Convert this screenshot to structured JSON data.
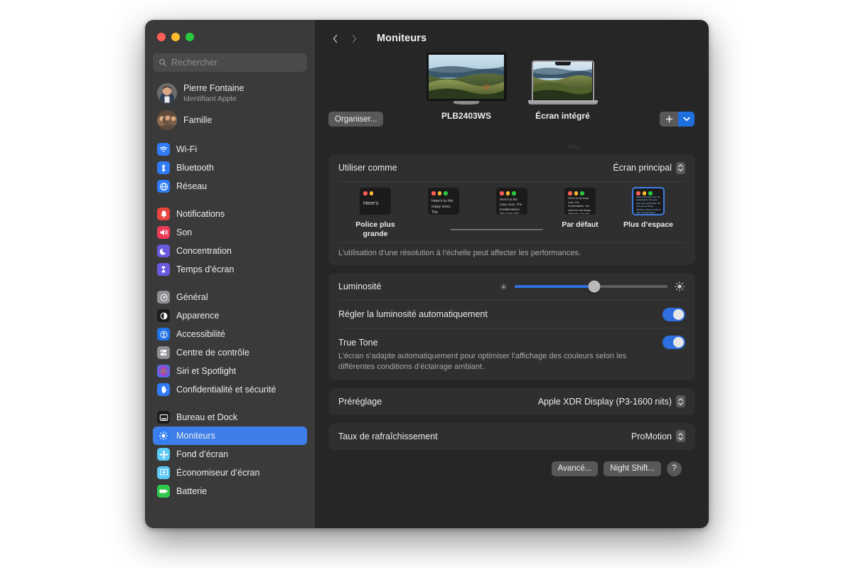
{
  "window": {
    "traffic_lights": [
      "close",
      "minimize",
      "zoom"
    ]
  },
  "sidebar": {
    "search": {
      "placeholder": "Rechercher",
      "value": ""
    },
    "accounts": [
      {
        "name": "Pierre Fontaine",
        "subtitle": "Identifiant Apple",
        "avatar": "user-photo"
      },
      {
        "name": "Famille",
        "avatar": "family-photos"
      }
    ],
    "groups": [
      {
        "items": [
          {
            "label": "Wi-Fi",
            "icon": "wifi-icon",
            "color": "#2f7cf6"
          },
          {
            "label": "Bluetooth",
            "icon": "bluetooth-icon",
            "color": "#2f7cf6"
          },
          {
            "label": "Réseau",
            "icon": "globe-icon",
            "color": "#2f7cf6"
          }
        ]
      },
      {
        "items": [
          {
            "label": "Notifications",
            "icon": "bell-icon",
            "color": "#e5453c"
          },
          {
            "label": "Son",
            "icon": "speaker-icon",
            "color": "#ec3b58"
          },
          {
            "label": "Concentration",
            "icon": "moon-icon",
            "color": "#6a5ae0"
          },
          {
            "label": "Temps d’écran",
            "icon": "hourglass-icon",
            "color": "#6a5ae0"
          }
        ]
      },
      {
        "items": [
          {
            "label": "Général",
            "icon": "gear-icon",
            "color": "#8e8e93"
          },
          {
            "label": "Apparence",
            "icon": "contrast-icon",
            "color": "#1c1c1e"
          },
          {
            "label": "Accessibilité",
            "icon": "accessibility-icon",
            "color": "#1d72e8"
          },
          {
            "label": "Centre de contrôle",
            "icon": "control-center-icon",
            "color": "#8e8e93"
          },
          {
            "label": "Siri et Spotlight",
            "icon": "siri-icon",
            "color": "#c13fa0"
          },
          {
            "label": "Confidentialité et sécurité",
            "icon": "hand-icon",
            "color": "#2f7cf6"
          }
        ]
      },
      {
        "items": [
          {
            "label": "Bureau et Dock",
            "icon": "desktop-dock-icon",
            "color": "#1c1c1e"
          },
          {
            "label": "Moniteurs",
            "icon": "brightness-icon",
            "color": "#2f7cf6",
            "selected": true
          },
          {
            "label": "Fond d’écran",
            "icon": "wallpaper-icon",
            "color": "#5bc8f5"
          },
          {
            "label": "Économiseur d’écran",
            "icon": "screensaver-icon",
            "color": "#5bc8f5"
          },
          {
            "label": "Batterie",
            "icon": "battery-icon",
            "color": "#30c94f"
          }
        ]
      }
    ]
  },
  "toolbar": {
    "back_icon": "chevron-left-icon",
    "forward_icon": "chevron-right-icon",
    "title": "Moniteurs"
  },
  "display_picker": {
    "displays": [
      {
        "name": "PLB2403WS",
        "type": "external-monitor",
        "selected": false
      },
      {
        "name": "Écran intégré",
        "type": "laptop",
        "selected": true
      }
    ],
    "arrange_button": "Organiser...",
    "add_button_icon": "plus-icon",
    "add_menu_icon": "chevron-down-icon"
  },
  "use_as": {
    "label": "Utiliser comme",
    "value": "Écran principal"
  },
  "resolution": {
    "options": [
      {
        "label": "Police plus grande",
        "preview": "Here’s",
        "selected": false
      },
      {
        "label": "",
        "preview": "Here’s to the crazy ones. The troublemakers.",
        "selected": false
      },
      {
        "label": "",
        "preview": "Here’s to the crazy ones. The troublemakers. The ones who see things differently.",
        "selected": false
      },
      {
        "label": "Par défaut",
        "preview": "Here’s to the crazy ones. The troublemakers. The ones who see things differently. And they have no respect for the status quo.",
        "selected": false
      },
      {
        "label": "Plus d’espace",
        "preview": "Here’s to the crazy ones. The troublemakers. The round pegs in the square holes. The ones who see things differently. They’re not fond of rules. And they have no respect for the status quo. You can quote them, disagree with them, glorify or vilify them. About the only thing you can’t do is ignore them.",
        "selected": true
      }
    ],
    "note": "L’utilisation d’une résolution à l’échelle peut affecter les performances."
  },
  "brightness": {
    "label": "Luminosité",
    "value_percent": 52,
    "min_icon": "sun-small-icon",
    "max_icon": "sun-large-icon",
    "auto_label": "Régler la luminosité automatiquement",
    "auto_enabled": true
  },
  "true_tone": {
    "label": "True Tone",
    "enabled": true,
    "description": "L’écran s’adapte automatiquement pour optimiser l’affichage des couleurs selon les différentes conditions d’éclairage ambiant."
  },
  "preset": {
    "label": "Préréglage",
    "value": "Apple XDR Display (P3-1600 nits)"
  },
  "refresh_rate": {
    "label": "Taux de rafraîchissement",
    "value": "ProMotion"
  },
  "footer": {
    "advanced": "Avancé...",
    "night_shift": "Night Shift...",
    "help": "?"
  },
  "colors": {
    "accent": "#2f6fe0",
    "selection": "#3d7ee8",
    "sidebar_bg": "#3a3a3a",
    "main_bg": "#262626",
    "card_bg": "#2f2f2f"
  }
}
